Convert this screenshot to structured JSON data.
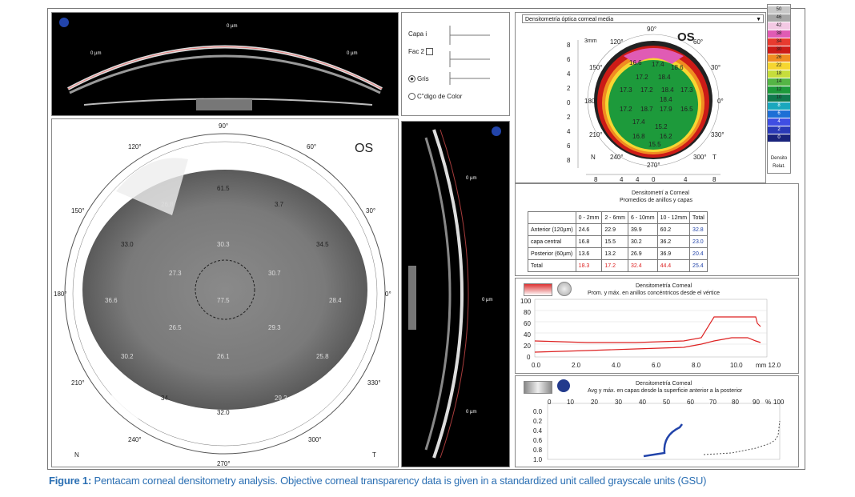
{
  "scheimpflug_top": {
    "labels": [
      "0 µm",
      "0 µm",
      "0 µm"
    ]
  },
  "controls": {
    "layer1": "Capa i",
    "layer2": "Fac 2",
    "gris": "Gris",
    "color_code": "C''digo de Color"
  },
  "main_map": {
    "eye": "OS",
    "n_label": "N",
    "t_label": "T",
    "angles": [
      "90°",
      "60°",
      "30°",
      "0°",
      "330°",
      "300°",
      "270°",
      "240°",
      "210°",
      "180°",
      "150°",
      "120°"
    ],
    "values": [
      "61.5",
      "26.8",
      "3.7",
      "33.0",
      "30.3",
      "34.5",
      "27.3",
      "30.7",
      "36.6",
      "77.5",
      "28.4",
      "26.5",
      "29.3",
      "30.2",
      "26.1",
      "25.8",
      "34.",
      "29.2",
      "32.0"
    ]
  },
  "vertical_slit": {
    "labels": [
      "0 µm",
      "0 µm",
      "0 µm"
    ]
  },
  "color_map": {
    "dropdown": "Densitometría óptica corneal media",
    "eye": "OS",
    "size": "3mm",
    "angles": [
      "90°",
      "120°",
      "60°",
      "150°",
      "30°",
      "180°",
      "0°",
      "210°",
      "330°",
      "240°",
      "270°",
      "300°"
    ],
    "n_label": "N",
    "t_label": "T",
    "y_ticks": [
      "8",
      "6",
      "4",
      "2",
      "0",
      "2",
      "4",
      "6",
      "8"
    ],
    "x_ticks": [
      "8",
      "4",
      "4",
      "0",
      "4",
      "8"
    ],
    "values": [
      "16.6",
      "17.4",
      "18.6",
      "17.2",
      "18.4",
      "17.3",
      "17.2",
      "18.4",
      "17.3",
      "18.4",
      "17.2",
      "18.7",
      "17.9",
      "16.5",
      "17.4",
      "15.2",
      "16.8",
      "16.2",
      "15.5"
    ]
  },
  "scale": {
    "values": [
      "50",
      "46",
      "42",
      "38",
      "34",
      "30",
      "26",
      "22",
      "18",
      "14",
      "12",
      "10",
      "8",
      "6",
      "4",
      "2",
      "0"
    ],
    "colors": [
      "#c8c8c8",
      "#a7a7a7",
      "#f3c9e4",
      "#e05bb4",
      "#e83a2f",
      "#cc1b17",
      "#f08c21",
      "#f6d631",
      "#c6dd3c",
      "#54b545",
      "#1d9a3b",
      "#10794d",
      "#1aa7bd",
      "#1d6fd6",
      "#3f4ee3",
      "#2a3ab7",
      "#19237c"
    ],
    "footer1": "Densito",
    "footer2": "Relat."
  },
  "table": {
    "title1": "Densitometrí a Corneal",
    "title2": "Promedios de anillos y capas",
    "headers": [
      "",
      "0 - 2mm",
      "2 - 6mm",
      "6 - 10mm",
      "10 - 12mm",
      "Total"
    ],
    "rows": [
      {
        "label": "Anterior (120µm)",
        "vals": [
          "24.6",
          "22.9",
          "39.9",
          "60.2",
          "32.8"
        ]
      },
      {
        "label": "capa central",
        "vals": [
          "16.8",
          "15.5",
          "30.2",
          "36.2",
          "23.0"
        ]
      },
      {
        "label": "Posterior (60µm)",
        "vals": [
          "13.6",
          "13.2",
          "26.9",
          "36.9",
          "20.4"
        ]
      },
      {
        "label": "Total",
        "vals": [
          "18.3",
          "17.2",
          "32.4",
          "44.4",
          "25.4"
        ]
      }
    ]
  },
  "chart1": {
    "title1": "Densitometría Corneal",
    "title2": "Prom. y máx. en anillos concéntricos desde el vértice",
    "y_ticks": [
      "100",
      "80",
      "60",
      "40",
      "20",
      "0"
    ],
    "x_ticks": [
      "0.0",
      "2.0",
      "4.0",
      "6.0",
      "8.0",
      "10.0"
    ],
    "x_unit": "mm 12.0"
  },
  "chart2": {
    "title1": "Densitometría Corneal",
    "title2": "Avg y máx. en capas desde la superficie anterior a la posterior",
    "x_ticks": [
      "0",
      "10",
      "20",
      "30",
      "40",
      "50",
      "60",
      "70",
      "80",
      "90",
      "%",
      "100"
    ],
    "y_ticks": [
      "0.0",
      "0.2",
      "0.4",
      "0.6",
      "0.8",
      "1.0"
    ]
  },
  "caption": {
    "bold": "Figure 1:",
    "text": " Pentacam corneal densitometry analysis. Objective corneal transparency data is given in a standardized unit called grayscale units (GSU)"
  }
}
